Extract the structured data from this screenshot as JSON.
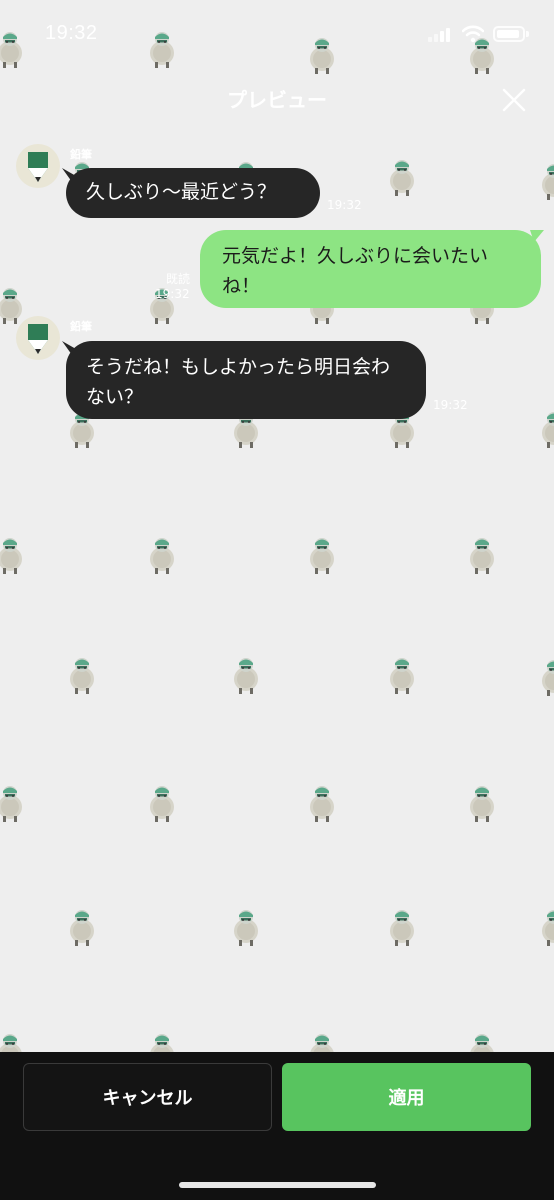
{
  "status_bar": {
    "time": "19:32",
    "signal_icon": "cellular-signal-icon",
    "wifi_icon": "wifi-icon",
    "battery_icon": "battery-icon"
  },
  "header": {
    "title": "プレビュー",
    "close_icon": "close-icon"
  },
  "chat": {
    "messages": [
      {
        "direction": "incoming",
        "sender": "鉛筆",
        "text": "久しぶり〜最近どう？",
        "time": "19:32"
      },
      {
        "direction": "outgoing",
        "text": "元気だよ！久しぶりに会いたいね！",
        "read_label": "既読",
        "time": "19:32"
      },
      {
        "direction": "incoming",
        "sender": "鉛筆",
        "text": "そうだね！もしよかったら明日会わない？",
        "time": "19:32"
      }
    ]
  },
  "footer": {
    "cancel_label": "キャンセル",
    "apply_label": "適用"
  },
  "colors": {
    "wallpaper": "#eeeeee",
    "incoming_bubble": "#262626",
    "outgoing_bubble": "#8de483",
    "apply_button": "#58c45f",
    "bottom_bar": "#111111"
  }
}
